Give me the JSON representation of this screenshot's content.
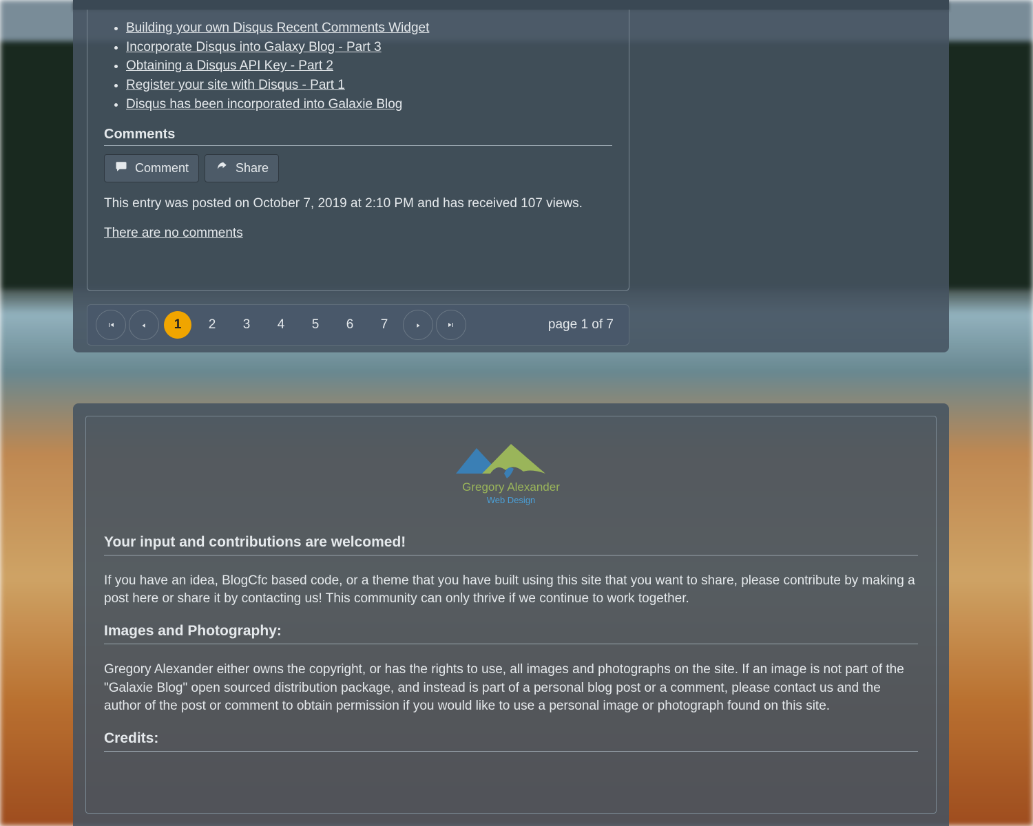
{
  "post": {
    "series_links": [
      "Building your own Disqus Recent Comments Widget",
      "Incorporate Disqus into Galaxy Blog - Part 3",
      "Obtaining a Disqus API Key - Part 2",
      "Register your site with Disqus - Part 1",
      "Disqus has been incorporated into Galaxie Blog"
    ],
    "comments_header": "Comments",
    "comment_button": "Comment",
    "share_button": "Share",
    "entry_meta": "This entry was posted on October 7, 2019 at 2:10 PM and has received 107 views.",
    "no_comments": "There are no comments"
  },
  "pager": {
    "pages": [
      "1",
      "2",
      "3",
      "4",
      "5",
      "6",
      "7"
    ],
    "active_index": 0,
    "info": "page 1 of 7"
  },
  "footer": {
    "logo_title": "Gregory Alexander",
    "logo_sub": "Web Design",
    "input_header": "Your input and contributions are welcomed!",
    "input_body": "If you have an idea, BlogCfc based code, or a theme that you have built using this site that you want to share, please contribute by making a post here or share it by contacting us! This community can only thrive if we continue to work together.",
    "images_header": "Images and Photography:",
    "images_body": "Gregory Alexander either owns the copyright, or has the rights to use, all images and photographs on the site. If an image is not part of the \"Galaxie Blog\" open sourced distribution package, and instead is part of a personal blog post or a comment, please contact us and the author of the post or comment to obtain permission if you would like to use a personal image or photograph found on this site.",
    "credits_header": "Credits:"
  }
}
